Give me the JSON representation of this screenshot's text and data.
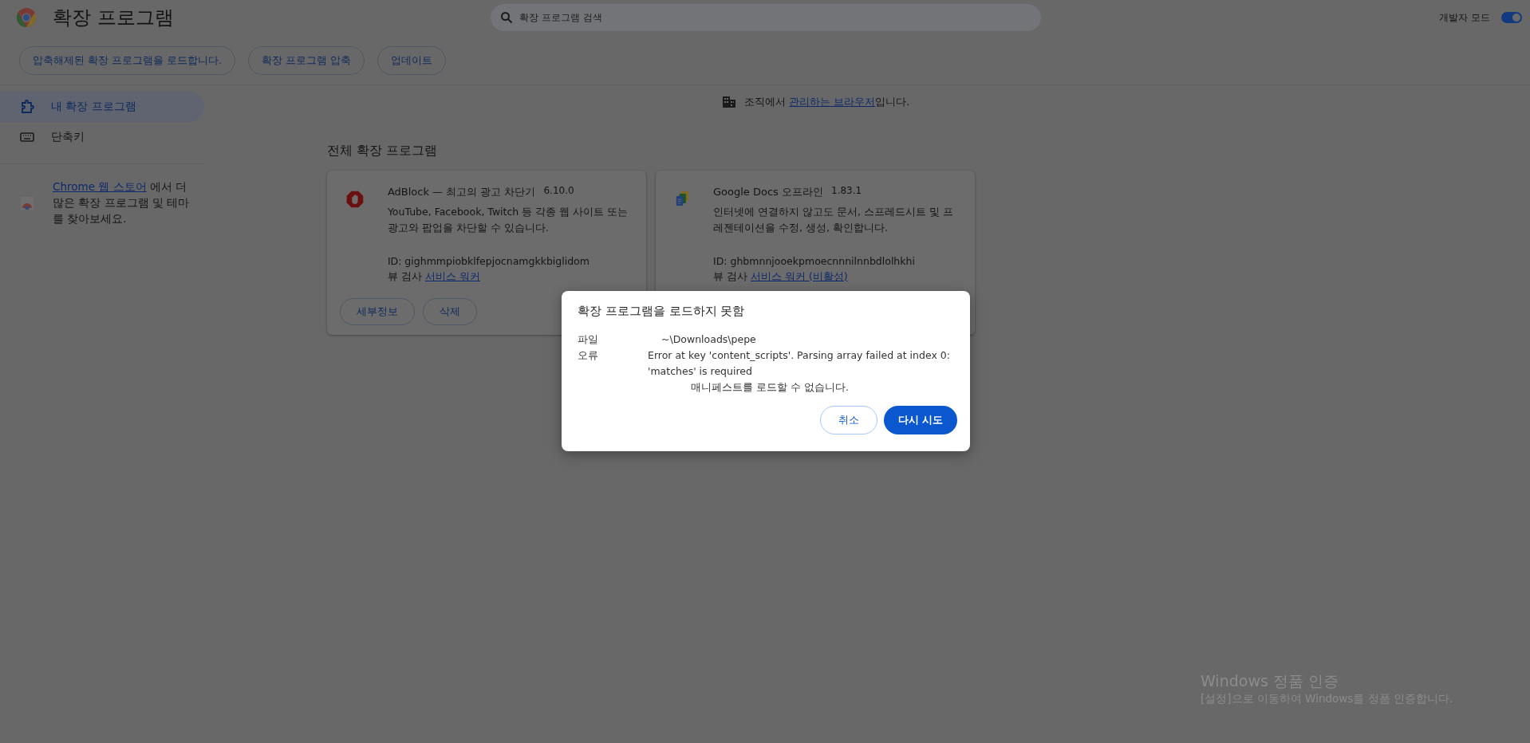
{
  "header": {
    "title": "확장 프로그램",
    "search": {
      "placeholder": "확장 프로그램 검색"
    },
    "developer_mode": {
      "label": "개발자 모드",
      "on": true
    }
  },
  "toolbar": {
    "buttons": [
      "압축해제된 확장 프로그램을 로드합니다.",
      "확장 프로그램 압축",
      "업데이트"
    ]
  },
  "sidebar": {
    "items": [
      {
        "label": "내 확장 프로그램",
        "kind": "puzzle",
        "selected": true
      },
      {
        "label": "단축키",
        "kind": "keyboard",
        "selected": false
      }
    ],
    "store_note": {
      "link": "Chrome 웹 스토어",
      "text": "에서 더 많은 확장 프로그램 및 테마를 찾아보세요."
    }
  },
  "managed_notice": {
    "before": "조직에서",
    "link": "관리하는 브라우저",
    "after": "입니다."
  },
  "section_title": "전체 확장 프로그램",
  "extensions": [
    {
      "name": "AdBlock — 최고의 광고 차단기",
      "version": "6.10.0",
      "kind": "adblock",
      "description": "YouTube, Facebook, Twitch 등 각종 웹 사이트 또는 광고와 팝업을 차단할 수 있습니다.",
      "id": "ID: gighmmpiobklfepjocnamgkkbiglidom",
      "inspect_label": "뷰 검사",
      "inspect_link": "서비스 워커",
      "buttons": [
        "세부정보",
        "삭제"
      ]
    },
    {
      "name": "Google Docs 오프라인",
      "version": "1.83.1",
      "kind": "docs",
      "description": "인터넷에 연결하지 않고도 문서, 스프레드시트 및 프레젠테이션을 수정, 생성, 확인합니다.",
      "id": "ID: ghbmnnjooekpmoecnnnilnnbdlolhkhi",
      "inspect_label": "뷰 검사",
      "inspect_link": "서비스 워커 (비활성)"
    }
  ],
  "dialog": {
    "title": "확장 프로그램을 로드하지 못함",
    "file_label": "파일",
    "file_value": "~\\Downloads\\pepe",
    "error_label": "오류",
    "error_value": "Error at key 'content_scripts'. Parsing array failed at index 0: 'matches' is required",
    "error_note": "매니페스트를 로드할 수 없습니다.",
    "cancel": "취소",
    "retry": "다시 시도"
  },
  "activation": {
    "title": "Windows 정품 인증",
    "text": "[설정]으로 이동하여 Windows를 정품 인증합니다."
  }
}
